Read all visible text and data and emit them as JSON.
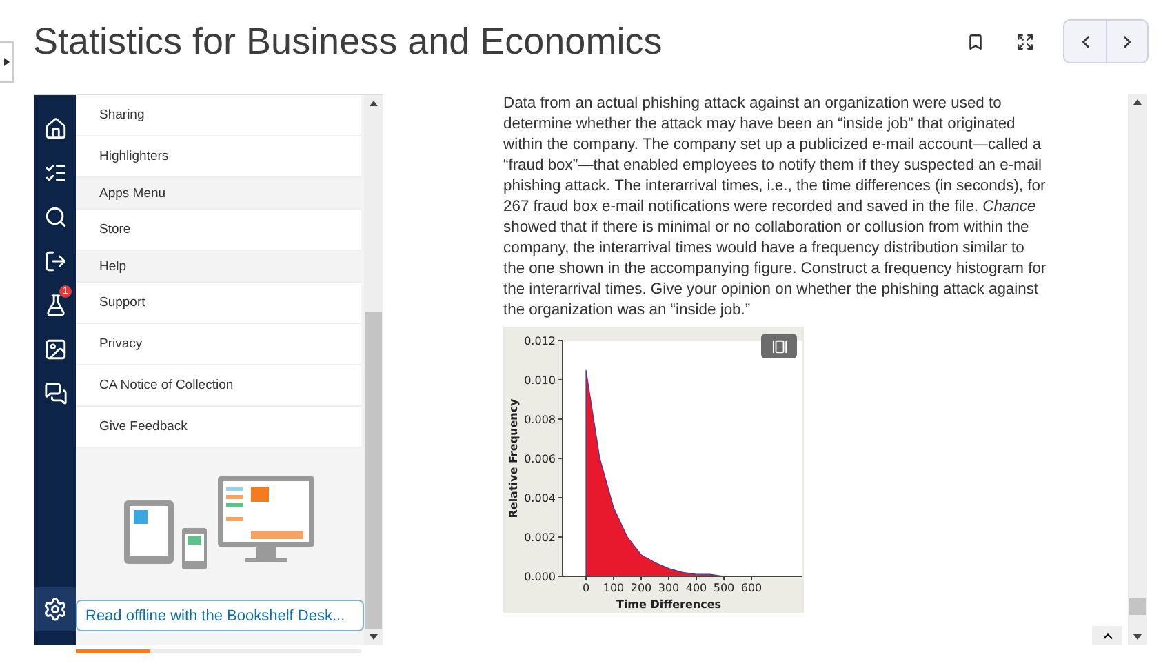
{
  "header": {
    "title": "Statistics for Business and Economics"
  },
  "sidebar": {
    "rail": [
      {
        "kind": "home"
      },
      {
        "kind": "contents"
      },
      {
        "kind": "search"
      },
      {
        "kind": "exit"
      },
      {
        "kind": "lab",
        "badge": "1"
      },
      {
        "kind": "media"
      },
      {
        "kind": "notes"
      }
    ],
    "menu": [
      {
        "kind": "item",
        "label": "Sharing"
      },
      {
        "kind": "item",
        "label": "Highlighters"
      },
      {
        "kind": "header",
        "label": "Apps Menu"
      },
      {
        "kind": "item",
        "label": "Store"
      },
      {
        "kind": "header",
        "label": "Help"
      },
      {
        "kind": "item",
        "label": "Support"
      },
      {
        "kind": "item",
        "label": "Privacy"
      },
      {
        "kind": "item",
        "label": "CA Notice of Collection"
      },
      {
        "kind": "item",
        "label": "Give Feedback"
      }
    ],
    "offline_button": "Read offline with the Bookshelf Desk...",
    "progress": {
      "level": 0.26
    }
  },
  "content": {
    "paragraph": "Data from an actual phishing attack against an organization were used to determine whether the attack may have been an “inside job” that originated within the company. The company set up a publicized e-mail account—called a “fraud box”—that enabled employees to notify them if they suspected an e-mail phishing attack. The interarrival times, i.e., the time differences (in seconds), for 267 fraud box e-mail notifications were recorded and saved in the file. *Chance* showed that if there is minimal or no collaboration or collusion from within the company, the interarrival times would have a frequency distribution similar to the one shown in the accompanying figure. Construct a frequency histogram for the interarrival times. Give your opinion on whether the phishing attack against the organization was an “inside job.”",
    "chart_data": {
      "type": "area",
      "xlabel": "Time Differences",
      "ylabel": "Relative Frequency",
      "x": [
        0,
        50,
        100,
        150,
        200,
        250,
        300,
        350,
        400,
        450,
        500,
        550,
        600
      ],
      "series": [
        {
          "color": "#e8192c",
          "values": [
            0.0105,
            0.006,
            0.0035,
            0.002,
            0.0011,
            0.0007,
            0.0004,
            0.0002,
            0.0001,
            0.0001,
            0,
            0,
            0
          ]
        }
      ],
      "xlim": [
        -85,
        785
      ],
      "ylim": [
        0,
        0.012
      ],
      "xticks": [
        0,
        100,
        200,
        300,
        400,
        500,
        600
      ],
      "yticks": [
        {
          "value": 0,
          "label": "0.000"
        },
        {
          "value": 0.002,
          "label": "0.002"
        },
        {
          "value": 0.004,
          "label": "0.004"
        },
        {
          "value": 0.006,
          "label": "0.006"
        },
        {
          "value": 0.008,
          "label": "0.008"
        },
        {
          "value": 0.01,
          "label": "0.010"
        },
        {
          "value": 0.012,
          "label": "0.012"
        }
      ]
    }
  }
}
